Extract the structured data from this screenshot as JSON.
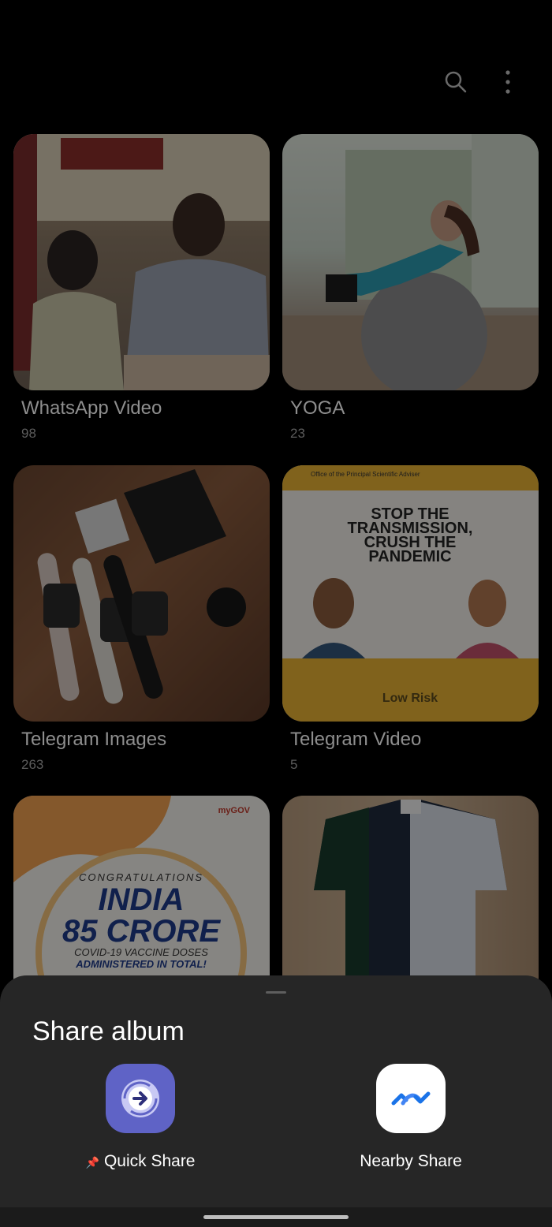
{
  "toolbar": {
    "search_icon": "search-icon",
    "more_icon": "more-vert-icon"
  },
  "albums": [
    {
      "name": "WhatsApp Video",
      "count": "98"
    },
    {
      "name": "YOGA",
      "count": "23"
    },
    {
      "name": "Telegram Images",
      "count": "263"
    },
    {
      "name": "Telegram Video",
      "count": "5"
    },
    {
      "name": "",
      "count": ""
    },
    {
      "name": "",
      "count": ""
    }
  ],
  "thumbs": {
    "telegram_video": {
      "header": "Office of the Principal Scientific Adviser",
      "headline1": "STOP THE",
      "headline2": "TRANSMISSION,",
      "headline3": "CRUSH THE",
      "headline4": "PANDEMIC",
      "footer": "Low Risk"
    },
    "vaccine": {
      "line1": "CONGRATULATIONS",
      "line2": "INDIA",
      "line3": "85 CRORE",
      "line4": "COVID-19 VACCINE DOSES",
      "line5": "ADMINISTERED IN TOTAL!",
      "badge": "myGOV"
    }
  },
  "share_sheet": {
    "title": "Share album",
    "options": [
      {
        "label": "Quick Share",
        "icon": "quick-share-icon"
      },
      {
        "label": "Nearby Share",
        "icon": "nearby-share-icon"
      }
    ]
  },
  "colors": {
    "sheet_bg": "#262626",
    "quick_share": "#5f63c6",
    "nearby_share": "#1a73e8"
  }
}
